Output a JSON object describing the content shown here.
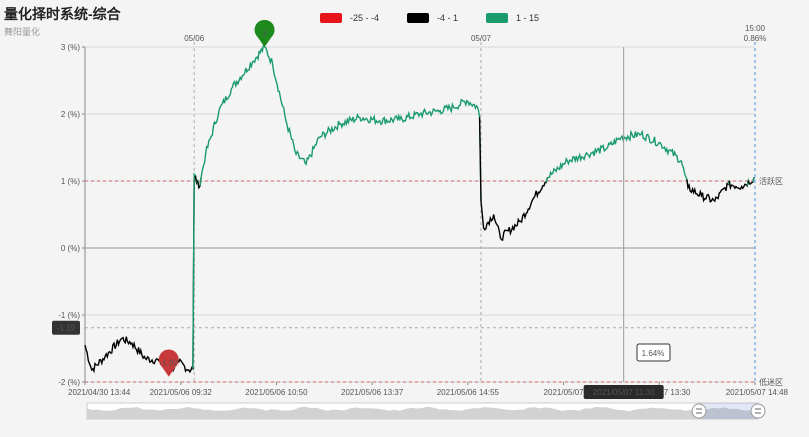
{
  "title": "量化择时系统-综合",
  "subtitle": "舞阳量化",
  "legend": [
    {
      "label": "-25 - -4",
      "color": "#e8141b"
    },
    {
      "label": "-4 - 1",
      "color": "#000000"
    },
    {
      "label": "1 - 15",
      "color": "#1a9b6c"
    }
  ],
  "chart_data": {
    "type": "line",
    "ylim": [
      -2,
      3
    ],
    "y_ticks": [
      "3 (%)",
      "2 (%)",
      "1 (%)",
      "0 (%)",
      "-1 (%)",
      "-2 (%)"
    ],
    "y_tick_values": [
      3,
      2,
      1,
      0,
      -1,
      -2
    ],
    "x_ticks": [
      "2021/04/30 13:44",
      "2021/05/06 09:32",
      "2021/05/06 10:50",
      "2021/05/06 13:37",
      "2021/05/06 14:55",
      "2021/05/07",
      "2021/05/07 13:30",
      "2021/05/07 14:48"
    ],
    "day_labels": [
      {
        "label": "05/06",
        "at": 0.163
      },
      {
        "label": "05/07",
        "at": 0.591
      }
    ],
    "threshold_lines": [
      {
        "value": 1,
        "label": "活跃区",
        "color": "#d06060"
      },
      {
        "value": -2,
        "label": "低迷区",
        "color": "#d06060"
      }
    ],
    "right_top": {
      "time": "15:00",
      "value": "0.86%"
    },
    "markers": [
      {
        "label": "3",
        "value": 3.0,
        "color": "#1e8a1e",
        "at": 0.268
      },
      {
        "label": "-1.92",
        "value": -1.92,
        "color": "#c83a3a",
        "at": 0.125
      }
    ],
    "crosshair": {
      "time_label": "2021/05/07 11:30",
      "y_label": "-1.19",
      "y_value": -1.19,
      "value_box": "1.64%",
      "at": 0.804
    },
    "anchors": [
      [
        0.0,
        -1.45
      ],
      [
        0.01,
        -1.82
      ],
      [
        0.03,
        -1.62
      ],
      [
        0.055,
        -1.35
      ],
      [
        0.07,
        -1.42
      ],
      [
        0.09,
        -1.65
      ],
      [
        0.11,
        -1.68
      ],
      [
        0.125,
        -1.85
      ],
      [
        0.14,
        -1.7
      ],
      [
        0.155,
        -1.82
      ],
      [
        0.161,
        -1.8
      ],
      [
        0.163,
        1.1
      ],
      [
        0.17,
        0.9
      ],
      [
        0.18,
        1.4
      ],
      [
        0.2,
        2.05
      ],
      [
        0.22,
        2.4
      ],
      [
        0.25,
        2.78
      ],
      [
        0.268,
        3.0
      ],
      [
        0.28,
        2.75
      ],
      [
        0.3,
        1.9
      ],
      [
        0.315,
        1.4
      ],
      [
        0.33,
        1.25
      ],
      [
        0.35,
        1.65
      ],
      [
        0.38,
        1.85
      ],
      [
        0.41,
        1.95
      ],
      [
        0.44,
        1.9
      ],
      [
        0.47,
        1.92
      ],
      [
        0.5,
        2.0
      ],
      [
        0.53,
        2.05
      ],
      [
        0.55,
        2.1
      ],
      [
        0.57,
        2.2
      ],
      [
        0.586,
        2.1
      ],
      [
        0.589,
        1.95
      ],
      [
        0.591,
        0.7
      ],
      [
        0.595,
        0.3
      ],
      [
        0.61,
        0.5
      ],
      [
        0.62,
        0.15
      ],
      [
        0.65,
        0.4
      ],
      [
        0.67,
        0.75
      ],
      [
        0.69,
        1.05
      ],
      [
        0.72,
        1.3
      ],
      [
        0.75,
        1.4
      ],
      [
        0.78,
        1.5
      ],
      [
        0.8,
        1.65
      ],
      [
        0.83,
        1.7
      ],
      [
        0.86,
        1.55
      ],
      [
        0.89,
        1.3
      ],
      [
        0.9,
        0.9
      ],
      [
        0.92,
        0.78
      ],
      [
        0.94,
        0.7
      ],
      [
        0.96,
        0.95
      ],
      [
        0.98,
        0.92
      ],
      [
        1.0,
        1.05
      ]
    ]
  }
}
